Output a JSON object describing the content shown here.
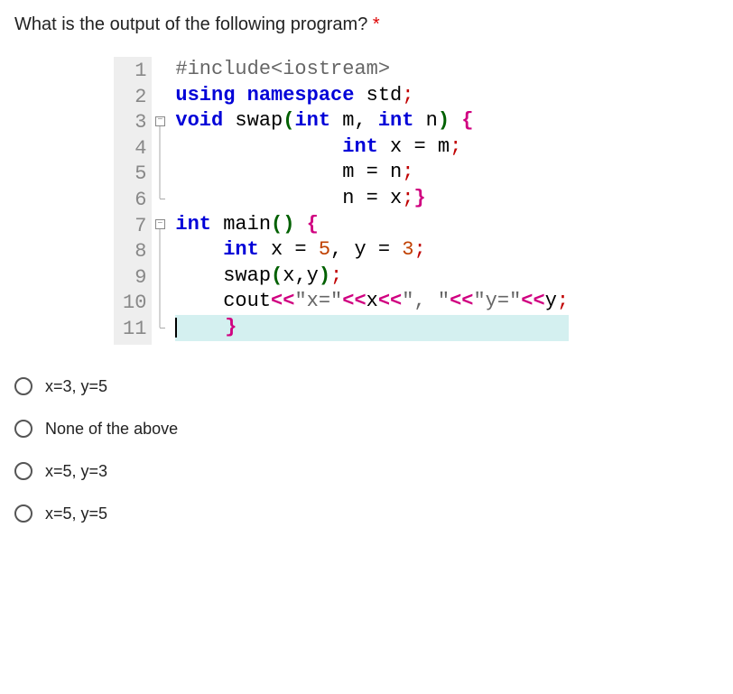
{
  "question": {
    "text": "What is the output of the following program?",
    "required": "*"
  },
  "code": {
    "line_numbers": [
      "1",
      "2",
      "3",
      "4",
      "5",
      "6",
      "7",
      "8",
      "9",
      "10",
      "11"
    ],
    "lines": {
      "l1_preproc": "#include<iostream>",
      "l2_kw1": "using",
      "l2_kw2": "namespace",
      "l2_ident": " std",
      "l2_semi": ";",
      "l3_kw1": "void",
      "l3_func": " swap",
      "l3_p1": "(",
      "l3_kw2": "int",
      "l3_a1": " m",
      "l3_c": ",",
      "l3_kw3": " int",
      "l3_a2": " n",
      "l3_p2": ")",
      "l3_br": " {",
      "l4_sp": "              ",
      "l4_kw": "int",
      "l4_rest": " x = m",
      "l4_semi": ";",
      "l5_sp": "              ",
      "l5_rest": "m = n",
      "l5_semi": ";",
      "l6_sp": "              ",
      "l6_rest": "n = x",
      "l6_semi": ";",
      "l6_br": "}",
      "l7_kw": "int",
      "l7_func": " main",
      "l7_p1": "(",
      "l7_p2": ")",
      "l7_br": " {",
      "l8_sp": "    ",
      "l8_kw": "int",
      "l8_r1": " x = ",
      "l8_n1": "5",
      "l8_c": ",",
      "l8_r2": " y = ",
      "l8_n2": "3",
      "l8_semi": ";",
      "l9_sp": "    ",
      "l9_func": "swap",
      "l9_p1": "(",
      "l9_a1": "x",
      "l9_c": ",",
      "l9_a2": "y",
      "l9_p2": ")",
      "l9_semi": ";",
      "l10_sp": "    ",
      "l10_cout": "cout",
      "l10_op1": "<<",
      "l10_s1": "\"x=\"",
      "l10_op2": "<<",
      "l10_x": "x",
      "l10_op3": "<<",
      "l10_s2": "\", \"",
      "l10_op4": "<<",
      "l10_s3": "\"y=\"",
      "l10_op5": "<<",
      "l10_y": "y",
      "l10_semi": ";",
      "l11_sp": "    ",
      "l11_br": "}"
    }
  },
  "options": [
    {
      "label": "x=3, y=5"
    },
    {
      "label": "None of the above"
    },
    {
      "label": "x=5, y=3"
    },
    {
      "label": "x=5, y=5"
    }
  ]
}
